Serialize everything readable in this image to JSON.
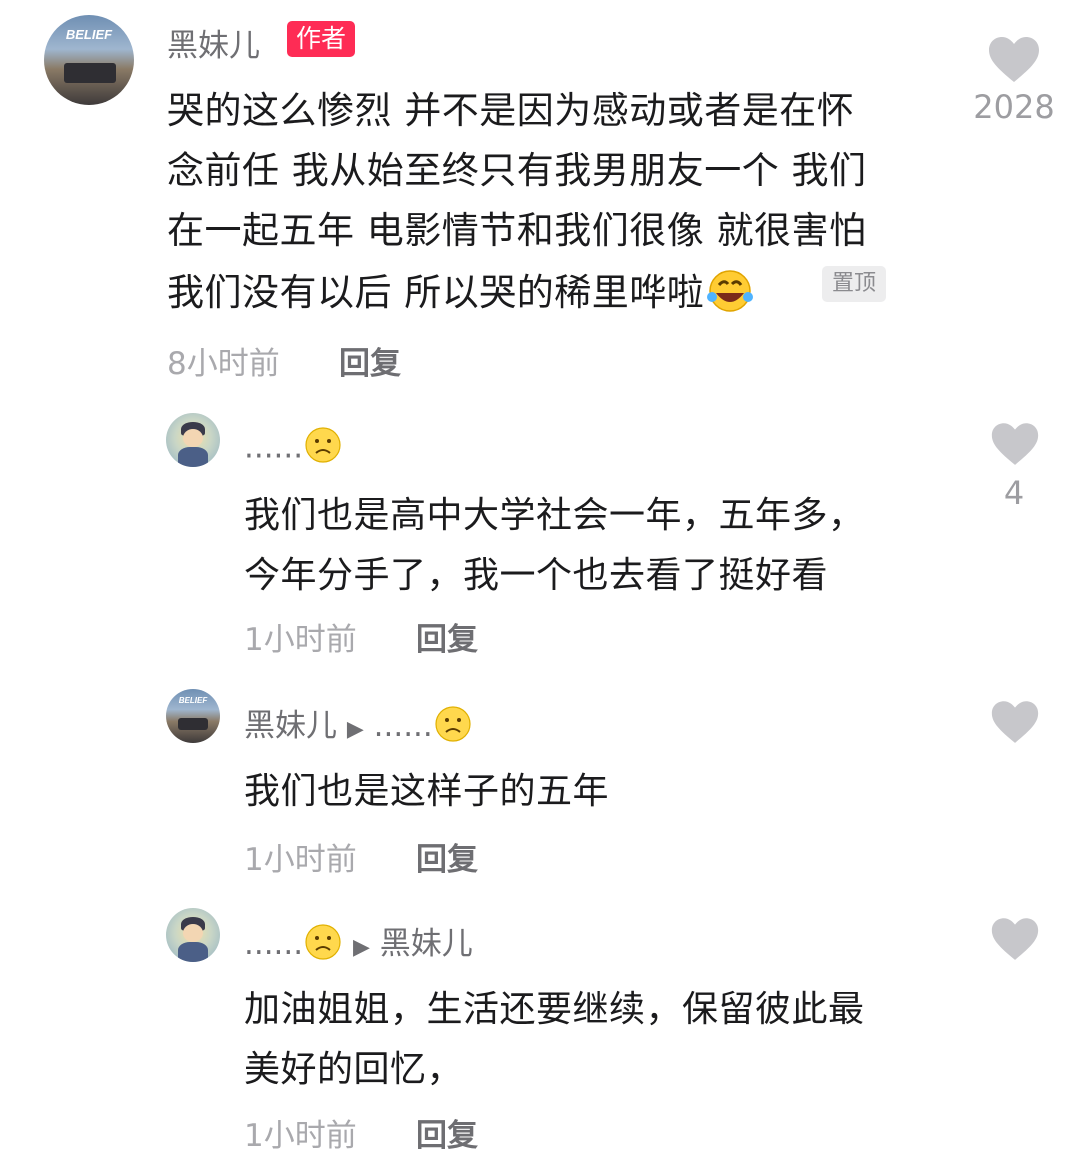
{
  "comments": [
    {
      "author": "黑妹儿",
      "author_badge": "作者",
      "avatar_tag": "BELIEF",
      "lines": [
        "哭的这么惨烈 并不是因为感动或者是在怀",
        "念前任 我从始至终只有我男朋友一个 我们",
        "在一起五年 电影情节和我们很像 就很害怕",
        "我们没有以后 所以哭的稀里哗啦"
      ],
      "pinned_label": "置顶",
      "time": "8小时前",
      "reply_label": "回复",
      "likes": "2028",
      "icons": {
        "like": "heart-icon",
        "emoji": "rofl-emoji-icon"
      }
    }
  ],
  "replies": [
    {
      "author": "......",
      "author_emoji": "frowning-face-icon",
      "lines": [
        "我们也是高中大学社会一年，五年多，",
        "今年分手了，我一个也去看了挺好看"
      ],
      "time": "1小时前",
      "reply_label": "回复",
      "likes": "4"
    },
    {
      "author": "黑妹儿",
      "avatar_tag": "BELIEF",
      "reply_to": "......",
      "reply_to_emoji": "frowning-face-icon",
      "lines": [
        "我们也是这样子的五年"
      ],
      "time": "1小时前",
      "reply_label": "回复",
      "likes": ""
    },
    {
      "author": "......",
      "author_emoji": "frowning-face-icon",
      "reply_to": "黑妹儿",
      "lines": [
        "加油姐姐，生活还要继续，保留彼此最",
        "美好的回忆，"
      ],
      "time": "1小时前",
      "reply_label": "回复",
      "likes": ""
    }
  ],
  "colors": {
    "badge": "#fe2c55",
    "heart": "#c7c7cb",
    "muted": "#a9a9ad"
  }
}
